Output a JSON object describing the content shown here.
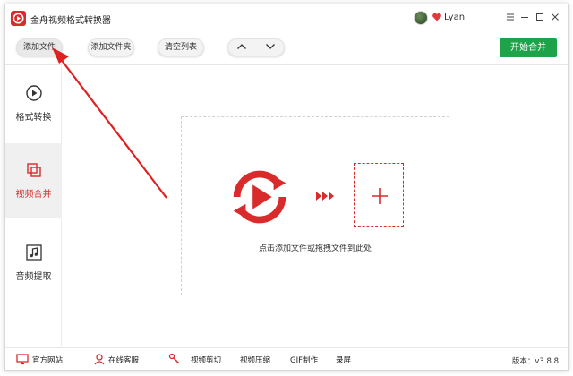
{
  "app": {
    "title": "金舟视频格式转换器",
    "username": "Lyan"
  },
  "toolbar": {
    "add_file": "添加文件",
    "add_folder": "添加文件夹",
    "clear_list": "清空列表",
    "start_merge": "开始合并"
  },
  "sidebar": {
    "items": [
      {
        "label": "格式转换",
        "icon": "play-circle-icon"
      },
      {
        "label": "视频合并",
        "icon": "merge-icon",
        "active": true
      },
      {
        "label": "音频提取",
        "icon": "music-note-icon"
      }
    ]
  },
  "main": {
    "drop_hint": "点击添加文件或拖拽文件到此处"
  },
  "bottombar": {
    "official_site": "官方网站",
    "online_service": "在线客服",
    "video_cut": "视频剪切",
    "video_compress": "视频压缩",
    "gif_make": "GIF制作",
    "screen_record": "录屏",
    "version": "版本：v3.8.8"
  },
  "colors": {
    "accent": "#d92b2b",
    "start_button": "#1fa34a"
  }
}
